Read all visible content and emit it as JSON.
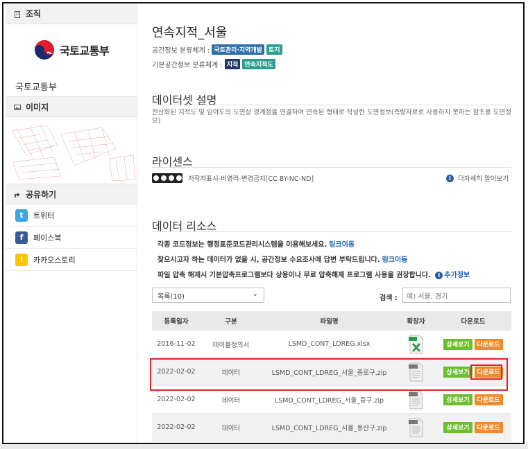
{
  "sidebar": {
    "org_header": "조직",
    "org_logo_text": "국토교통부",
    "org_name": "국토교통부",
    "image_header": "이미지",
    "share_header": "공유하기",
    "share_items": [
      {
        "label": "트위터",
        "icon": "twitter-icon",
        "color": "#3aa7e0",
        "glyph": "t"
      },
      {
        "label": "페이스북",
        "icon": "facebook-icon",
        "color": "#3b5998",
        "glyph": "f"
      },
      {
        "label": "카카오스토리",
        "icon": "kakaostory-icon",
        "color": "#f7c600",
        "glyph": "!"
      }
    ]
  },
  "main": {
    "title": "연속지적_서울",
    "classification_label": "공간정보 분류체계 :",
    "classification_badges": [
      "국토관리·지역개발",
      "토지"
    ],
    "base_classification_label": "기본공간정보 분류체계 :",
    "base_classification_badges": [
      "지적",
      "연속지적도"
    ],
    "dataset_desc_title": "데이터셋 설명",
    "dataset_desc": "전산화된 지적도 및 임야도의 도면상 경계점을 연결하여 연속된 형태로 작성한 도면정보(측량자료로 사용하지 못하는 참조용 도면정보)",
    "license_title": "라이센스",
    "license_text": "저작자표시-비영리-변경금지[CC BY-NC-ND]",
    "license_more": "더자세히 알아보기",
    "resource_title": "데이터 리소스",
    "notices": [
      {
        "text": "각종 코드정보는 행정표준코드관리시스템을 이용해보세요.",
        "link": "링크이동"
      },
      {
        "text": "찾으시고자 하는 데이터가 없을 시, 공간정보 수요조사에 답변 부탁드립니다.",
        "link": "링크이동"
      },
      {
        "text": "파일 압축 해제시 기본압축프로그램보다 상용이나 무료 압축해제 프로그램 사용을 권장합니다.",
        "link": "추가정보"
      }
    ],
    "list_select": "목록(10)",
    "search_label": "검색 :",
    "search_placeholder": "예) 서울, 경기",
    "table": {
      "headers": [
        "등록일자",
        "구분",
        "파일명",
        "확장자",
        "다운로드"
      ],
      "detail_label": "상세보기",
      "download_label": "다운로드",
      "rows": [
        {
          "date": "2016-11-02",
          "type": "테이블정의서",
          "file": "LSMD_CONT_LDREG.xlsx",
          "ext": "xlsx"
        },
        {
          "date": "2022-02-02",
          "type": "데이터",
          "file": "LSMD_CONT_LDREG_서울_종로구.zip",
          "ext": "zip"
        },
        {
          "date": "2022-02-02",
          "type": "데이터",
          "file": "LSMD_CONT_LDREG_서울_중구.zip",
          "ext": "zip"
        },
        {
          "date": "2022-02-02",
          "type": "데이터",
          "file": "LSMD_CONT_LDREG_서울_용산구.zip",
          "ext": "zip"
        }
      ]
    }
  },
  "colors": {
    "highlight": "#e0262c",
    "detail_button": "#6abf2e",
    "download_button": "#f28a2b",
    "link": "#1f5fb5"
  }
}
